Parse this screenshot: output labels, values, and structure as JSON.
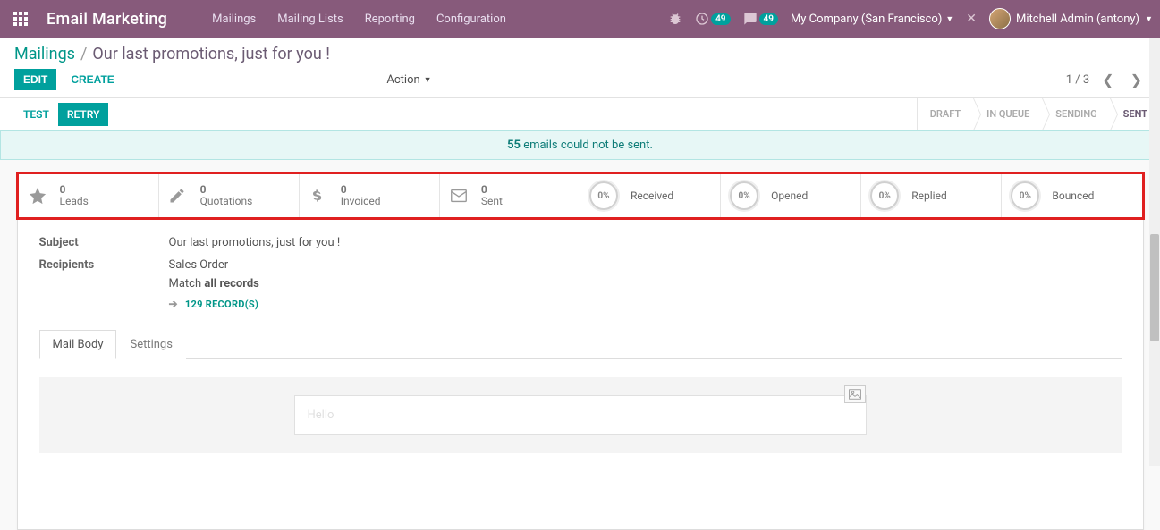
{
  "navbar": {
    "app_title": "Email Marketing",
    "menu": [
      "Mailings",
      "Mailing Lists",
      "Reporting",
      "Configuration"
    ],
    "debug_badge": "49",
    "messaging_badge": "49",
    "company": "My Company (San Francisco)",
    "user": "Mitchell Admin (antony)"
  },
  "breadcrumb": {
    "parent": "Mailings",
    "current": "Our last promotions, just for you !"
  },
  "buttons": {
    "edit": "EDIT",
    "create": "CREATE",
    "action": "Action"
  },
  "pager": {
    "text": "1 / 3"
  },
  "statusbar": {
    "test": "TEST",
    "retry": "RETRY",
    "steps": [
      "DRAFT",
      "IN QUEUE",
      "SENDING",
      "SENT"
    ],
    "active_step": "SENT"
  },
  "alert": {
    "count": "55",
    "text": " emails could not be sent."
  },
  "stats": {
    "counts": [
      {
        "num": "0",
        "label": "Leads"
      },
      {
        "num": "0",
        "label": "Quotations"
      },
      {
        "num": "0",
        "label": "Invoiced"
      },
      {
        "num": "0",
        "label": "Sent"
      }
    ],
    "percents": [
      {
        "pct": "0%",
        "label": "Received"
      },
      {
        "pct": "0%",
        "label": "Opened"
      },
      {
        "pct": "0%",
        "label": "Replied"
      },
      {
        "pct": "0%",
        "label": "Bounced"
      }
    ]
  },
  "form": {
    "subject_label": "Subject",
    "subject_value": "Our last promotions, just for you !",
    "recipients_label": "Recipients",
    "recipients_value": "Sales Order",
    "match_pre": "Match ",
    "match_bold": "all records",
    "records_link": "129 RECORD(S)"
  },
  "tabs": {
    "body": "Mail Body",
    "settings": "Settings"
  },
  "preview": {
    "greeting": "Hello"
  }
}
